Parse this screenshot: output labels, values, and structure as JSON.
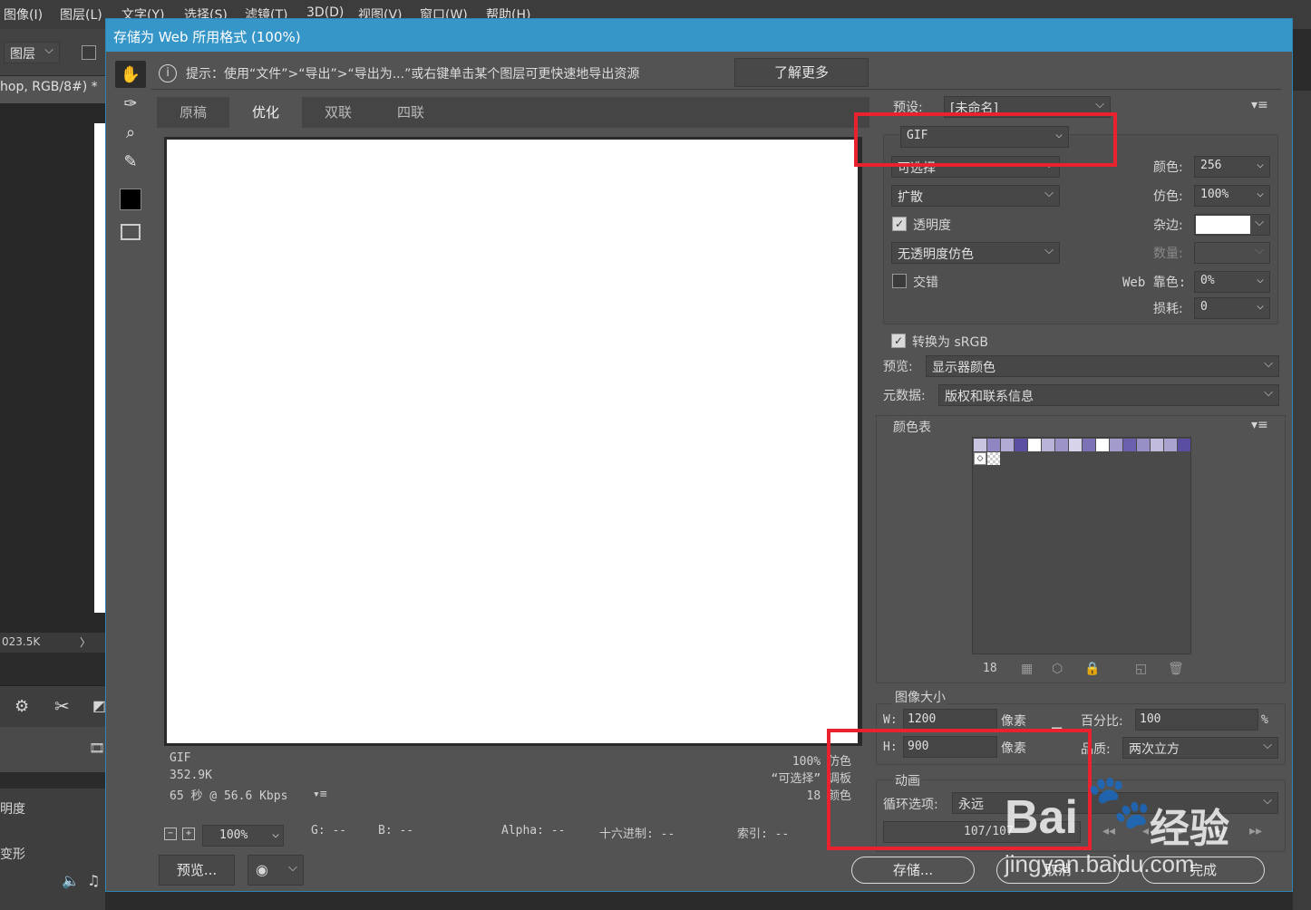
{
  "ps": {
    "menu": [
      "图像(I)",
      "图层(L)",
      "文字(Y)",
      "选择(S)",
      "滤镜(T)",
      "3D(D)",
      "视图(V)",
      "窗口(W)",
      "帮助(H)"
    ],
    "layers_dropdown": "图层",
    "doc_tab": "hop, RGB/8#) *",
    "status_size": "023.5K",
    "panel_items": [
      "明度",
      "变形"
    ]
  },
  "dialog": {
    "title": "存储为 Web 所用格式 (100%)",
    "hint": "提示：使用“文件”>“导出”>“导出为...”或右键单击某个图层可更快速地导出资源",
    "learn_more": "了解更多",
    "tabs": [
      "原稿",
      "优化",
      "双联",
      "四联"
    ],
    "active_tab": "优化",
    "preview_info": {
      "format": "GIF",
      "size": "352.9K",
      "time": "65 秒 @ 56.6 Kbps",
      "zoom_pct": "100% 仿色",
      "palette": "“可选择” 调板",
      "colors": "18 颜色"
    },
    "zoom": {
      "value": "100%",
      "g": "G: --",
      "b": "B: --",
      "alpha": "Alpha: --",
      "hex": "十六进制: --",
      "index": "索引: --"
    },
    "preview_btn": "预览...",
    "save_btn": "存储...",
    "cancel_btn": "取消",
    "done_btn": "完成"
  },
  "settings": {
    "preset_label": "预设:",
    "preset_value": "[未命名]",
    "format": "GIF",
    "reduction": "可选择",
    "dither_algo": "扩散",
    "transparency_label": "透明度",
    "transparency_checked": true,
    "trans_dither": "无透明度仿色",
    "interlace_label": "交错",
    "interlace_checked": false,
    "colors_label": "颜色:",
    "colors_value": "256",
    "dither_label": "仿色:",
    "dither_value": "100%",
    "matte_label": "杂边:",
    "amount_label": "数量:",
    "web_snap_label": "Web 靠色:",
    "web_snap_value": "0%",
    "lossy_label": "损耗:",
    "lossy_value": "0",
    "convert_srgb_label": "转换为 sRGB",
    "convert_srgb_checked": true,
    "preview_label": "预览:",
    "preview_value": "显示器颜色",
    "metadata_label": "元数据:",
    "metadata_value": "版权和联系信息",
    "color_table_label": "颜色表",
    "color_count": "18",
    "swatch_colors": [
      "#c9c4e0",
      "#8f86c2",
      "#b0aad4",
      "#5b4fa4",
      "#ffffff",
      "#b9b3d8",
      "#9c94c8",
      "#d7d3ea",
      "#7c72b6",
      "#ffffff",
      "#a39bcc",
      "#6b60ad",
      "#9790c6",
      "#c1bcdd",
      "#aaa3d0",
      "#5a4ea2"
    ],
    "image_size_label": "图像大小",
    "w_label": "W:",
    "w_value": "1200",
    "h_label": "H:",
    "h_value": "900",
    "px_label": "像素",
    "percent_label": "百分比:",
    "percent_value": "100",
    "percent_unit": "%",
    "quality_label": "品质:",
    "quality_value": "两次立方",
    "animation_label": "动画",
    "loop_label": "循环选项:",
    "loop_value": "永远",
    "frame_counter": "107/107"
  },
  "watermark": {
    "brand": "Bai",
    "brand_cn": "经验",
    "url": "jingyan.baidu.com"
  },
  "colors": {
    "dialog_bg": "#535353",
    "titlebar": "#3696c8",
    "highlight": "#e8232f"
  }
}
